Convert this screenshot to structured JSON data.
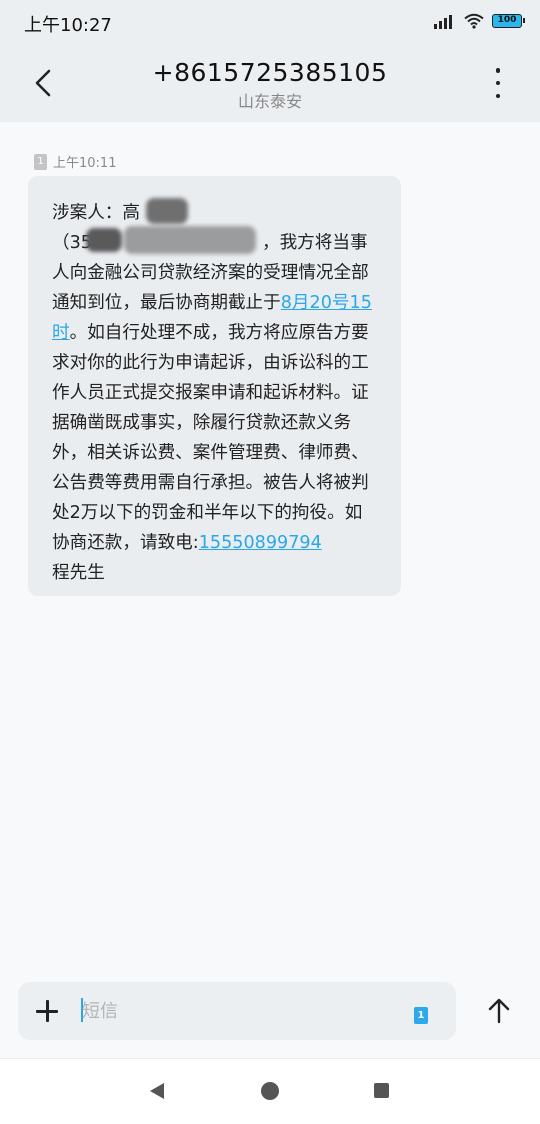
{
  "status_bar": {
    "time": "上午10:27",
    "battery_level": "100",
    "icons": [
      "signal-icon",
      "wifi-icon",
      "battery-icon"
    ]
  },
  "header": {
    "title": "+8615725385105",
    "subtitle": "山东泰安",
    "back_icon": "back-arrow-icon",
    "more_icon": "more-vertical-icon"
  },
  "message": {
    "sim_slot": "1",
    "timestamp": "上午10:11",
    "parts": {
      "p1": "涉案人：高\n（35",
      "p1b": "，我方将当事人向金融公司贷款经济案的受理情况全部通知到位，最后协商期截止于",
      "link1": "8月20号15时",
      "p2": "。如自行处理不成，我方将应原告方要求对你的此行为申请起诉，由诉讼科的工作人员正式提交报案申请和起诉材料。证据确凿既成事实，除履行贷款还款义务外，相关诉讼费、案件管理费、律师费、公告费等费用需自行承担。被告人将被判处2万以下的罚金和半年以下的拘役。如 协商还款，请致电:",
      "link2": "15550899794",
      "p3": "\n程先生"
    }
  },
  "compose": {
    "placeholder": "短信",
    "sim_slot": "1",
    "add_icon": "plus-icon",
    "send_icon": "send-arrow-icon"
  },
  "nav_bar": {
    "icons": [
      "nav-back-icon",
      "nav-home-icon",
      "nav-recents-icon"
    ]
  },
  "colors": {
    "accent": "#2aa7e8",
    "bubble": "#eaedf0",
    "header_bg": "#eceff2"
  }
}
